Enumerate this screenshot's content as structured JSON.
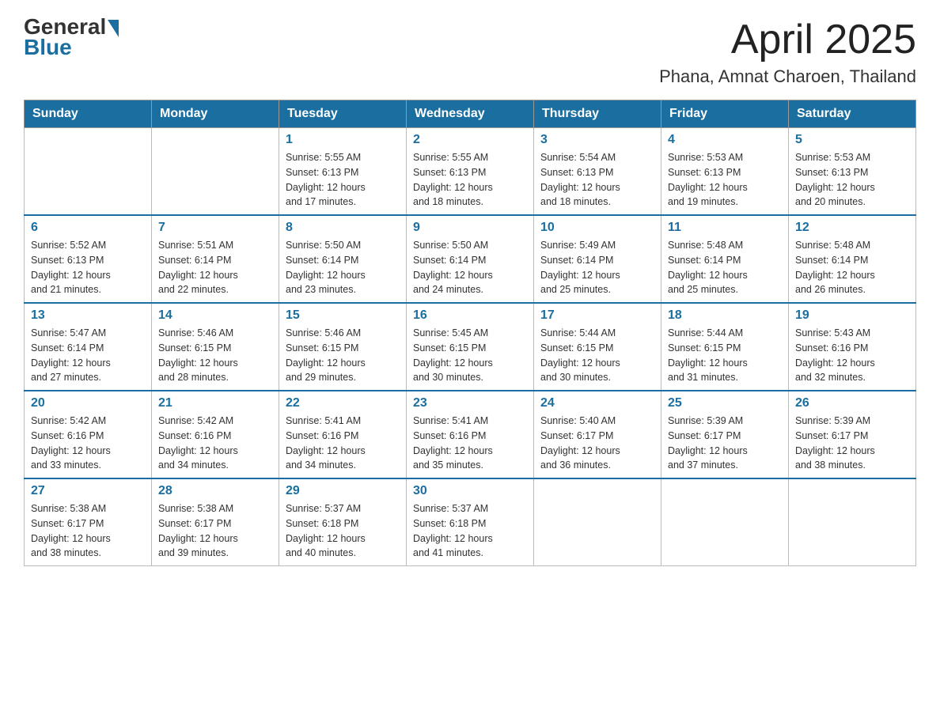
{
  "header": {
    "logo_general": "General",
    "logo_blue": "Blue",
    "month_year": "April 2025",
    "location": "Phana, Amnat Charoen, Thailand"
  },
  "days_of_week": [
    "Sunday",
    "Monday",
    "Tuesday",
    "Wednesday",
    "Thursday",
    "Friday",
    "Saturday"
  ],
  "weeks": [
    [
      {
        "day": "",
        "info": ""
      },
      {
        "day": "",
        "info": ""
      },
      {
        "day": "1",
        "info": "Sunrise: 5:55 AM\nSunset: 6:13 PM\nDaylight: 12 hours\nand 17 minutes."
      },
      {
        "day": "2",
        "info": "Sunrise: 5:55 AM\nSunset: 6:13 PM\nDaylight: 12 hours\nand 18 minutes."
      },
      {
        "day": "3",
        "info": "Sunrise: 5:54 AM\nSunset: 6:13 PM\nDaylight: 12 hours\nand 18 minutes."
      },
      {
        "day": "4",
        "info": "Sunrise: 5:53 AM\nSunset: 6:13 PM\nDaylight: 12 hours\nand 19 minutes."
      },
      {
        "day": "5",
        "info": "Sunrise: 5:53 AM\nSunset: 6:13 PM\nDaylight: 12 hours\nand 20 minutes."
      }
    ],
    [
      {
        "day": "6",
        "info": "Sunrise: 5:52 AM\nSunset: 6:13 PM\nDaylight: 12 hours\nand 21 minutes."
      },
      {
        "day": "7",
        "info": "Sunrise: 5:51 AM\nSunset: 6:14 PM\nDaylight: 12 hours\nand 22 minutes."
      },
      {
        "day": "8",
        "info": "Sunrise: 5:50 AM\nSunset: 6:14 PM\nDaylight: 12 hours\nand 23 minutes."
      },
      {
        "day": "9",
        "info": "Sunrise: 5:50 AM\nSunset: 6:14 PM\nDaylight: 12 hours\nand 24 minutes."
      },
      {
        "day": "10",
        "info": "Sunrise: 5:49 AM\nSunset: 6:14 PM\nDaylight: 12 hours\nand 25 minutes."
      },
      {
        "day": "11",
        "info": "Sunrise: 5:48 AM\nSunset: 6:14 PM\nDaylight: 12 hours\nand 25 minutes."
      },
      {
        "day": "12",
        "info": "Sunrise: 5:48 AM\nSunset: 6:14 PM\nDaylight: 12 hours\nand 26 minutes."
      }
    ],
    [
      {
        "day": "13",
        "info": "Sunrise: 5:47 AM\nSunset: 6:14 PM\nDaylight: 12 hours\nand 27 minutes."
      },
      {
        "day": "14",
        "info": "Sunrise: 5:46 AM\nSunset: 6:15 PM\nDaylight: 12 hours\nand 28 minutes."
      },
      {
        "day": "15",
        "info": "Sunrise: 5:46 AM\nSunset: 6:15 PM\nDaylight: 12 hours\nand 29 minutes."
      },
      {
        "day": "16",
        "info": "Sunrise: 5:45 AM\nSunset: 6:15 PM\nDaylight: 12 hours\nand 30 minutes."
      },
      {
        "day": "17",
        "info": "Sunrise: 5:44 AM\nSunset: 6:15 PM\nDaylight: 12 hours\nand 30 minutes."
      },
      {
        "day": "18",
        "info": "Sunrise: 5:44 AM\nSunset: 6:15 PM\nDaylight: 12 hours\nand 31 minutes."
      },
      {
        "day": "19",
        "info": "Sunrise: 5:43 AM\nSunset: 6:16 PM\nDaylight: 12 hours\nand 32 minutes."
      }
    ],
    [
      {
        "day": "20",
        "info": "Sunrise: 5:42 AM\nSunset: 6:16 PM\nDaylight: 12 hours\nand 33 minutes."
      },
      {
        "day": "21",
        "info": "Sunrise: 5:42 AM\nSunset: 6:16 PM\nDaylight: 12 hours\nand 34 minutes."
      },
      {
        "day": "22",
        "info": "Sunrise: 5:41 AM\nSunset: 6:16 PM\nDaylight: 12 hours\nand 34 minutes."
      },
      {
        "day": "23",
        "info": "Sunrise: 5:41 AM\nSunset: 6:16 PM\nDaylight: 12 hours\nand 35 minutes."
      },
      {
        "day": "24",
        "info": "Sunrise: 5:40 AM\nSunset: 6:17 PM\nDaylight: 12 hours\nand 36 minutes."
      },
      {
        "day": "25",
        "info": "Sunrise: 5:39 AM\nSunset: 6:17 PM\nDaylight: 12 hours\nand 37 minutes."
      },
      {
        "day": "26",
        "info": "Sunrise: 5:39 AM\nSunset: 6:17 PM\nDaylight: 12 hours\nand 38 minutes."
      }
    ],
    [
      {
        "day": "27",
        "info": "Sunrise: 5:38 AM\nSunset: 6:17 PM\nDaylight: 12 hours\nand 38 minutes."
      },
      {
        "day": "28",
        "info": "Sunrise: 5:38 AM\nSunset: 6:17 PM\nDaylight: 12 hours\nand 39 minutes."
      },
      {
        "day": "29",
        "info": "Sunrise: 5:37 AM\nSunset: 6:18 PM\nDaylight: 12 hours\nand 40 minutes."
      },
      {
        "day": "30",
        "info": "Sunrise: 5:37 AM\nSunset: 6:18 PM\nDaylight: 12 hours\nand 41 minutes."
      },
      {
        "day": "",
        "info": ""
      },
      {
        "day": "",
        "info": ""
      },
      {
        "day": "",
        "info": ""
      }
    ]
  ]
}
